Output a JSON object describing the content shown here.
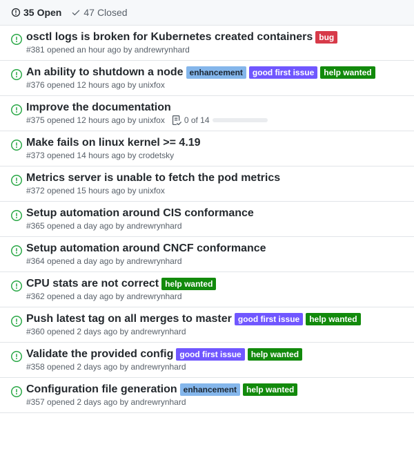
{
  "tabs": {
    "open_count": "35",
    "open_label": "Open",
    "closed_count": "47",
    "closed_label": "Closed"
  },
  "label_colors": {
    "bug": {
      "bg": "#d73a49",
      "fg": "#ffffff"
    },
    "enhancement": {
      "bg": "#84b6eb",
      "fg": "#1c2733"
    },
    "good first issue": {
      "bg": "#7057ff",
      "fg": "#ffffff"
    },
    "help wanted": {
      "bg": "#128A0C",
      "fg": "#ffffff"
    }
  },
  "issues": [
    {
      "title": "osctl logs is broken for Kubernetes created containers",
      "labels": [
        "bug"
      ],
      "meta": "#381 opened an hour ago by andrewrynhard"
    },
    {
      "title": "An ability to shutdown a node",
      "labels": [
        "enhancement",
        "good first issue",
        "help wanted"
      ],
      "meta": "#376 opened 12 hours ago by unixfox"
    },
    {
      "title": "Improve the documentation",
      "labels": [],
      "meta": "#375 opened 12 hours ago by unixfox",
      "tasks": "0 of 14"
    },
    {
      "title": "Make fails on linux kernel >= 4.19",
      "labels": [],
      "meta": "#373 opened 14 hours ago by crodetsky"
    },
    {
      "title": "Metrics server is unable to fetch the pod metrics",
      "labels": [],
      "meta": "#372 opened 15 hours ago by unixfox"
    },
    {
      "title": "Setup automation around CIS conformance",
      "labels": [],
      "meta": "#365 opened a day ago by andrewrynhard"
    },
    {
      "title": "Setup automation around CNCF conformance",
      "labels": [],
      "meta": "#364 opened a day ago by andrewrynhard"
    },
    {
      "title": "CPU stats are not correct",
      "labels": [
        "help wanted"
      ],
      "meta": "#362 opened a day ago by andrewrynhard"
    },
    {
      "title": "Push latest tag on all merges to master",
      "labels": [
        "good first issue",
        "help wanted"
      ],
      "meta": "#360 opened 2 days ago by andrewrynhard"
    },
    {
      "title": "Validate the provided config",
      "labels": [
        "good first issue",
        "help wanted"
      ],
      "meta": "#358 opened 2 days ago by andrewrynhard"
    },
    {
      "title": "Configuration file generation",
      "labels": [
        "enhancement",
        "help wanted"
      ],
      "meta": "#357 opened 2 days ago by andrewrynhard"
    }
  ]
}
